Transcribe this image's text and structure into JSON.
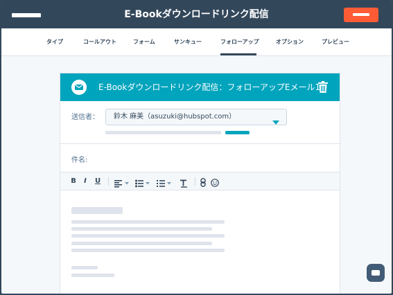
{
  "header": {
    "title": "E-Bookダウンロードリンク配信"
  },
  "tabs": [
    {
      "label": "タイプ"
    },
    {
      "label": "コールアウト"
    },
    {
      "label": "フォーム"
    },
    {
      "label": "サンキュー"
    },
    {
      "label": "フォローアップ",
      "active": true
    },
    {
      "label": "オプション"
    },
    {
      "label": "プレビュー"
    }
  ],
  "email_card": {
    "title": "E-Bookダウンロードリンク配信：フォローアップEメール1",
    "sender_label": "送信者：",
    "sender_value": "鈴木 麻美（asuzuki@hubspot.com）",
    "subject_label": "件名:"
  },
  "toolbar": {
    "bold": "B",
    "italic": "I",
    "underline": "U",
    "items": [
      "bold-icon",
      "italic-icon",
      "underline-icon",
      "align-icon",
      "bullet-list-icon",
      "numbered-list-icon",
      "clear-format-icon",
      "link-icon",
      "emoji-icon"
    ]
  },
  "colors": {
    "header_bg": "#33475b",
    "accent_orange": "#ff5c35",
    "accent_teal": "#00a4bd",
    "page_bg": "#f5f8fa"
  }
}
